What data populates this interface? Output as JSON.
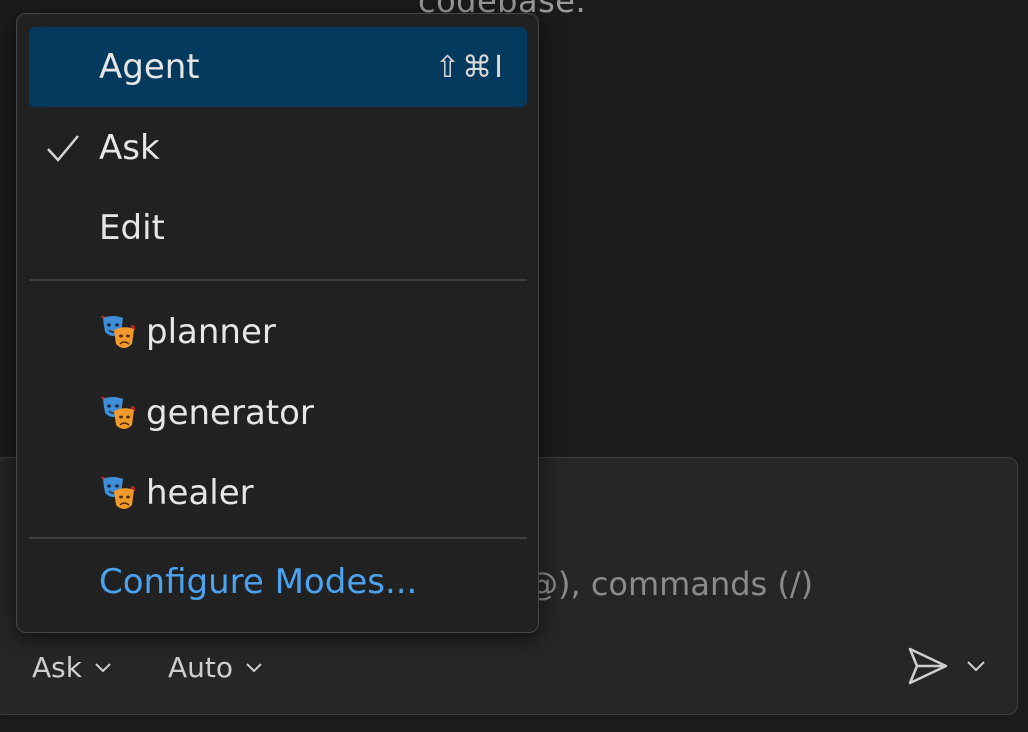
{
  "background": {
    "text": "codebase."
  },
  "chat": {
    "placeholder_fragment": "@), commands (/)",
    "mode_button_label": "Ask",
    "model_button_label": "Auto"
  },
  "menu": {
    "builtin_modes": [
      {
        "label": "Agent",
        "shortcut": "⇧⌘I",
        "highlighted": true,
        "checked": false
      },
      {
        "label": "Ask",
        "shortcut": "",
        "highlighted": false,
        "checked": true
      },
      {
        "label": "Edit",
        "shortcut": "",
        "highlighted": false,
        "checked": false
      }
    ],
    "custom_modes": [
      {
        "label": "planner",
        "icon": "performing-arts-masks-icon"
      },
      {
        "label": "generator",
        "icon": "performing-arts-masks-icon"
      },
      {
        "label": "healer",
        "icon": "performing-arts-masks-icon"
      }
    ],
    "configure_label": "Configure Modes..."
  },
  "colors": {
    "highlight": "#04395e",
    "link": "#4ba3f0",
    "menu_bg": "#212122",
    "page_bg": "#1b1b1c"
  }
}
